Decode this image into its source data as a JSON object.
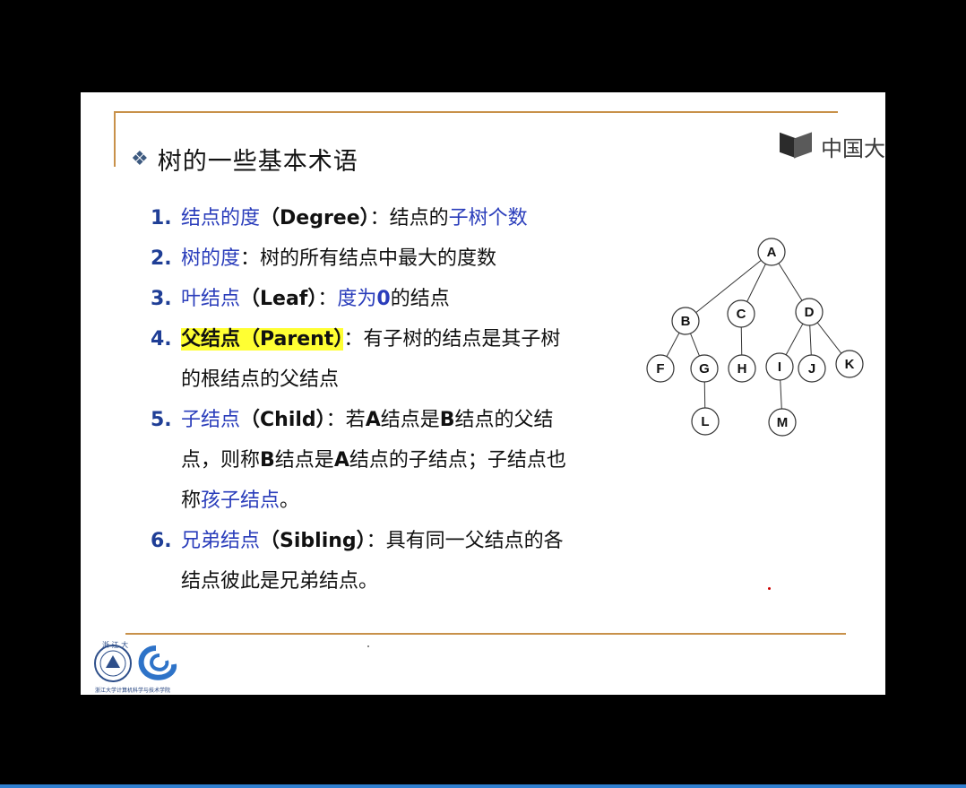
{
  "slide": {
    "heading": "树的一些基本术语",
    "mooc_logo_text": "中国大",
    "items": [
      {
        "num": "1.",
        "term": "结点的度",
        "paren": "（Degree）",
        "sep": "：",
        "text1": "结点的",
        "link": "子树个数"
      },
      {
        "num": "2.",
        "term": "树的度",
        "sep": "：",
        "text": "树的所有结点中最大的度数"
      },
      {
        "num": "3.",
        "term": "叶结点",
        "paren": "（Leaf）",
        "sep": "：",
        "def_pre": "度为",
        "def_num": "0",
        "def_post": "的结点"
      },
      {
        "num": "4.",
        "term": "父结点（Parent）",
        "sep": "：",
        "text": "有子树的结点是其子树",
        "text_cont": "的根结点的父结点"
      },
      {
        "num": "5.",
        "term": "子结点",
        "paren": "（Child）",
        "sep": "：",
        "line1": [
          "若",
          "A",
          "结点是",
          "B",
          "结点的父结"
        ],
        "line2": [
          "点，则称",
          "B",
          "结点是",
          "A",
          "结点的子结点；子结点也"
        ],
        "line3_pre": "称",
        "line3_link": "孩子结点",
        "line3_post": "。"
      },
      {
        "num": "6.",
        "term": "兄弟结点",
        "paren": "（Sibling）",
        "sep": "：",
        "text": "具有同一父结点的各",
        "text_cont": "结点彼此是兄弟结点。"
      }
    ]
  },
  "tree": {
    "nodes": [
      "A",
      "B",
      "C",
      "D",
      "F",
      "G",
      "H",
      "I",
      "J",
      "K",
      "L",
      "M"
    ],
    "edges": [
      [
        "A",
        "B"
      ],
      [
        "A",
        "C"
      ],
      [
        "A",
        "D"
      ],
      [
        "B",
        "F"
      ],
      [
        "B",
        "G"
      ],
      [
        "C",
        "H"
      ],
      [
        "D",
        "I"
      ],
      [
        "D",
        "J"
      ],
      [
        "D",
        "K"
      ],
      [
        "G",
        "L"
      ],
      [
        "I",
        "M"
      ]
    ]
  },
  "footer": {
    "caption": "浙江大学计算机科学与技术学院"
  },
  "colors": {
    "accent_rule": "#c8914a",
    "term_blue": "#2a3dbb",
    "number_blue": "#1f3e96",
    "highlight": "#ffff33",
    "background": "#000000"
  }
}
